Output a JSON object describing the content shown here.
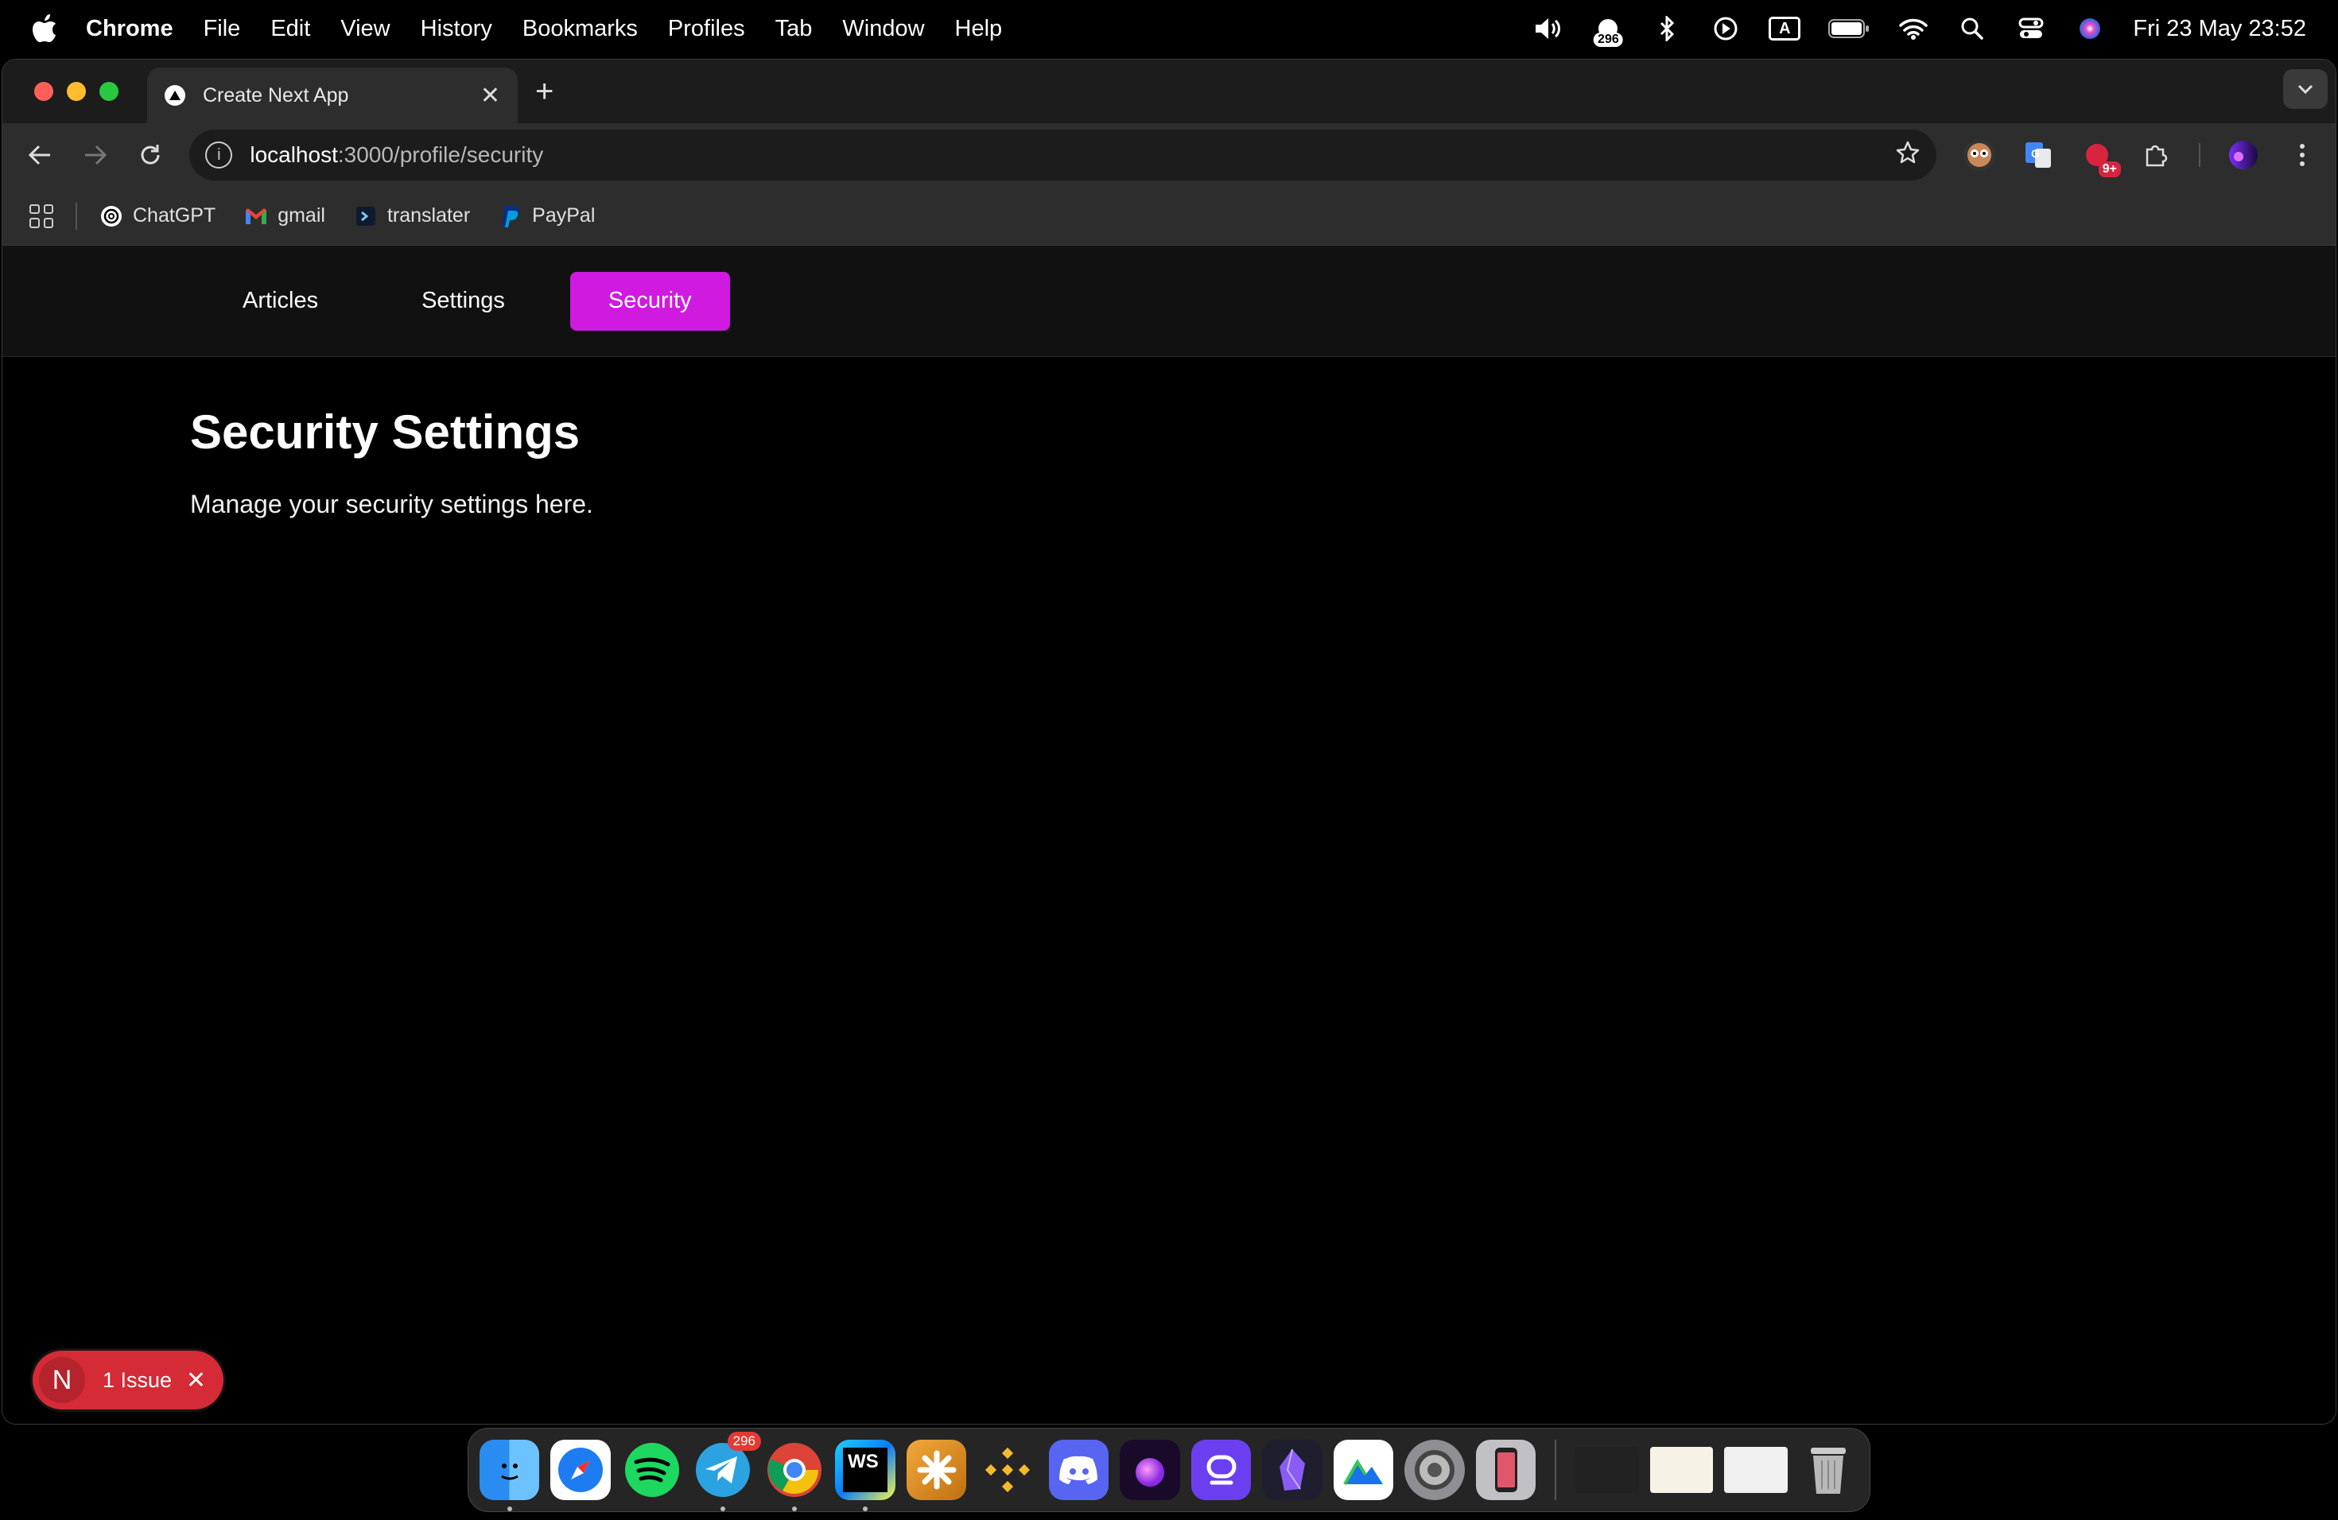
{
  "menubar": {
    "app_name": "Chrome",
    "items": [
      "File",
      "Edit",
      "View",
      "History",
      "Bookmarks",
      "Profiles",
      "Tab",
      "Window",
      "Help"
    ],
    "notification_count": "296",
    "input_indicator": "A",
    "datetime": "Fri 23 May  23:52"
  },
  "browser": {
    "tab_title": "Create Next App",
    "url_host": "localhost",
    "url_path": ":3000/profile/security",
    "extension_badge": "9+",
    "bookmarks": [
      {
        "label": "ChatGPT",
        "icon": "chatgpt-icon"
      },
      {
        "label": "gmail",
        "icon": "gmail-icon"
      },
      {
        "label": "translater",
        "icon": "translator-icon"
      },
      {
        "label": "PayPal",
        "icon": "paypal-icon"
      }
    ]
  },
  "page": {
    "nav": [
      "Articles",
      "Settings",
      "Security"
    ],
    "active_tab": "Security",
    "accent_color": "#d01ae0",
    "title": "Security Settings",
    "description": "Manage your security settings here."
  },
  "issue_overlay": {
    "logo": "N",
    "label": "1 Issue"
  },
  "dock": {
    "telegram_badge": "296",
    "webstorm_label": "WS"
  }
}
